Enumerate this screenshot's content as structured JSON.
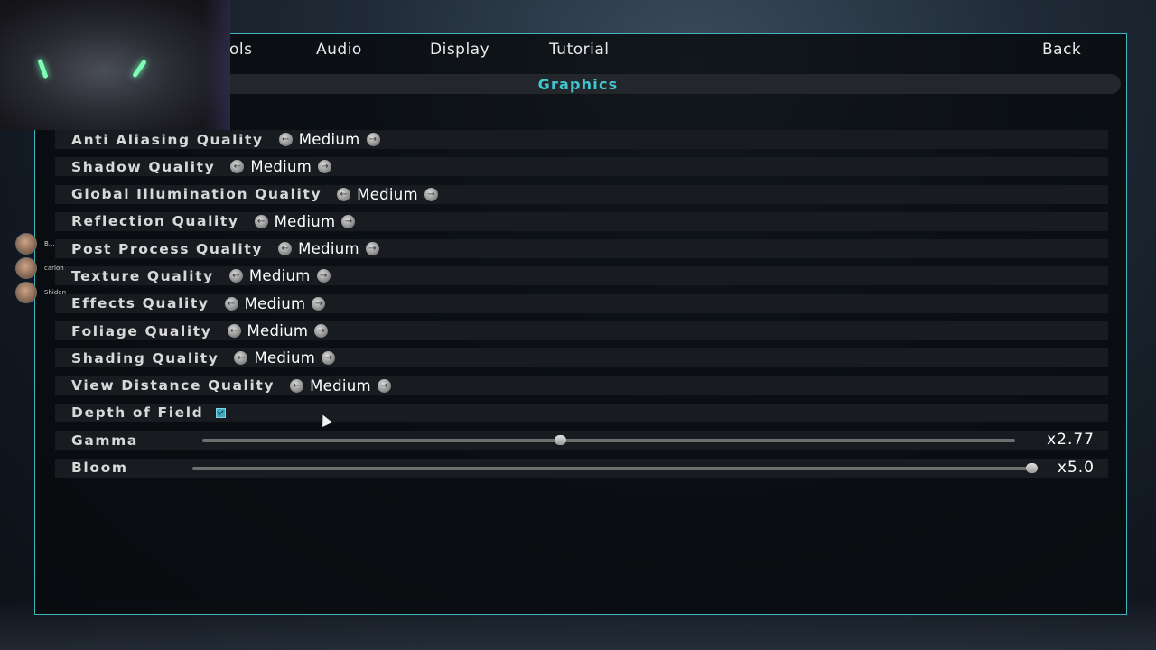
{
  "nav": {
    "tabs": [
      "ols",
      "Audio",
      "Display",
      "Tutorial"
    ],
    "back": "Back"
  },
  "section": {
    "title": "Graphics"
  },
  "settings": [
    {
      "label": "Anti Aliasing Quality",
      "type": "selector",
      "value": "Medium"
    },
    {
      "label": "Shadow Quality",
      "type": "selector",
      "value": "Medium"
    },
    {
      "label": "Global Illumination Quality",
      "type": "selector",
      "value": "Medium"
    },
    {
      "label": "Reflection Quality",
      "type": "selector",
      "value": "Medium"
    },
    {
      "label": "Post Process Quality",
      "type": "selector",
      "value": "Medium"
    },
    {
      "label": "Texture Quality",
      "type": "selector",
      "value": "Medium"
    },
    {
      "label": "Effects Quality",
      "type": "selector",
      "value": "Medium"
    },
    {
      "label": "Foliage Quality",
      "type": "selector",
      "value": "Medium"
    },
    {
      "label": "Shading Quality",
      "type": "selector",
      "value": "Medium"
    },
    {
      "label": "View Distance Quality",
      "type": "selector",
      "value": "Medium"
    },
    {
      "label": "Depth of Field",
      "type": "checkbox",
      "checked": true
    },
    {
      "label": "Gamma",
      "type": "slider",
      "value": "x2.77",
      "fraction": 0.44
    },
    {
      "label": "Bloom",
      "type": "slider",
      "value": "x5.0",
      "fraction": 1.0
    }
  ],
  "overlay": {
    "viewers": [
      "B...",
      "carloh",
      "Shiden"
    ]
  },
  "colors": {
    "accent": "#42c6cf",
    "panel_border": "#3fb5bf",
    "checkbox": "#3fa9c0"
  },
  "icons": {
    "prev": "chevron-left-icon",
    "next": "chevron-right-icon"
  }
}
